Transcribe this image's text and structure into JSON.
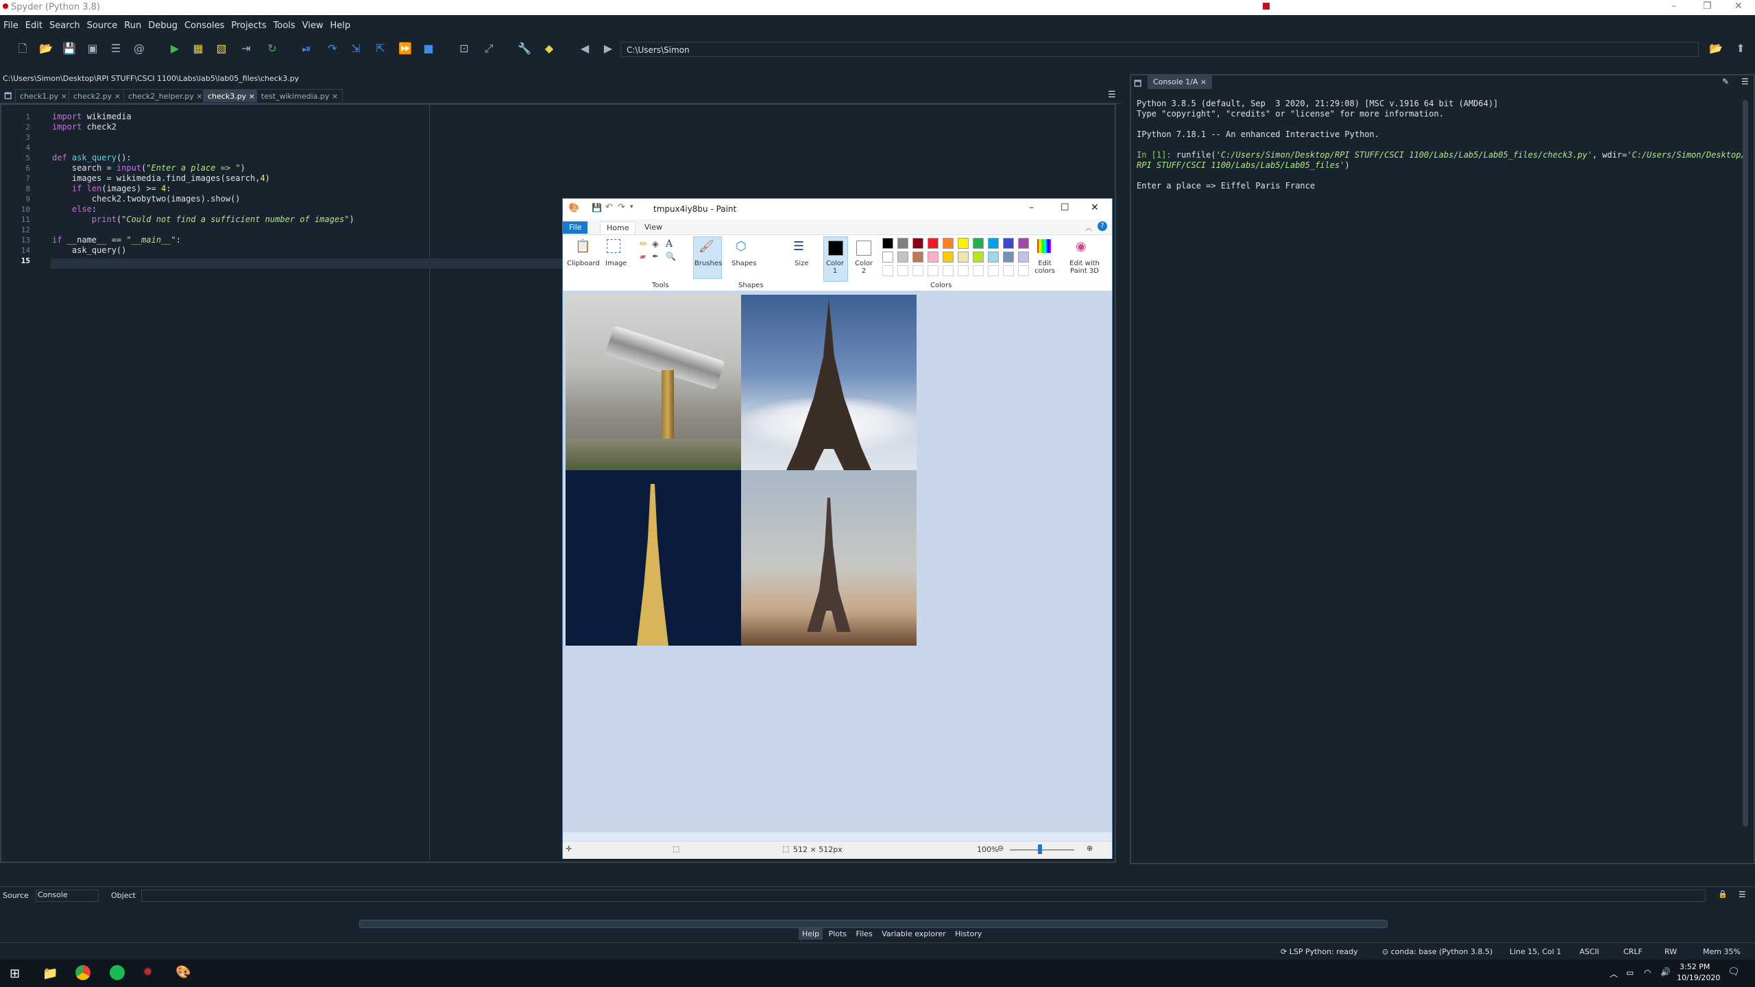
{
  "window": {
    "title": "Spyder (Python 3.8)"
  },
  "menu": [
    "File",
    "Edit",
    "Search",
    "Source",
    "Run",
    "Debug",
    "Consoles",
    "Projects",
    "Tools",
    "View",
    "Help"
  ],
  "toolbar": {
    "path": "C:\\Users\\Simon"
  },
  "editor": {
    "filepath": "C:\\Users\\Simon\\Desktop\\RPI STUFF\\CSCI 1100\\Labs\\lab5\\lab05_files\\check3.py",
    "tabs": [
      "check1.py",
      "check2.py",
      "check2_helper.py",
      "check3.py",
      "test_wikimedia.py"
    ],
    "active_tab": "check3.py",
    "line_numbers": [
      "1",
      "2",
      "3",
      "4",
      "5",
      "6",
      "7",
      "8",
      "9",
      "10",
      "11",
      "12",
      "13",
      "14",
      "15"
    ]
  },
  "console": {
    "tab": "Console 1/A",
    "lines": [
      "Python 3.8.5 (default, Sep  3 2020, 21:29:08) [MSC v.1916 64 bit (AMD64)]",
      "Type \"copyright\", \"credits\" or \"license\" for more information.",
      "",
      "IPython 7.18.1 -- An enhanced Interactive Python.",
      ""
    ],
    "prompt": "In [1]: ",
    "run_cmd": "runfile(",
    "run_file": "'C:/Users/Simon/Desktop/RPI STUFF/CSCI 1100/Labs/Lab5/Lab05_files/check3.py'",
    "run_wdir_label": ", wdir=",
    "run_wdir": "'C:/Users/Simon/Desktop/",
    "run_wdir2": "RPI STUFF/CSCI 1100/Labs/Lab5/Lab05_files'",
    "input_line": "Enter a place => Eiffel Paris France"
  },
  "paint": {
    "title": "tmpux4iy8bu - Paint",
    "tabs": [
      "File",
      "Home",
      "View"
    ],
    "groups": [
      "Clipboard",
      "Image",
      "Tools",
      "Brushes",
      "Shapes",
      "Size",
      "Color 1",
      "Color 2",
      "Edit colors",
      "Edit with Paint 3D"
    ],
    "group_labels": [
      "Tools",
      "Shapes",
      "Colors"
    ],
    "dimensions": "512 × 512px",
    "zoom": "100%",
    "palette": [
      "#000000",
      "#7f7f7f",
      "#880015",
      "#ed1c24",
      "#ff7f27",
      "#fff200",
      "#22b14c",
      "#00a2e8",
      "#3f48cc",
      "#a349a4",
      "#ffffff",
      "#c3c3c3",
      "#b97a57",
      "#ffaec9",
      "#ffc90e",
      "#efe4b0",
      "#b5e61d",
      "#99d9ea",
      "#7092be",
      "#c8bfe7"
    ]
  },
  "bottom": {
    "source_label": "Source",
    "source_value": "Console",
    "object_label": "Object",
    "tabs": [
      "Help",
      "Plots",
      "Files",
      "Variable explorer",
      "History"
    ]
  },
  "status": {
    "lsp": "LSP Python: ready",
    "conda": "conda: base (Python 3.8.5)",
    "position": "Line 15, Col 1",
    "encoding": "ASCII",
    "eol": "CRLF",
    "rw": "RW",
    "mem": "Mem 35%"
  },
  "taskbar": {
    "time": "3:52 PM",
    "date": "10/19/2020"
  }
}
